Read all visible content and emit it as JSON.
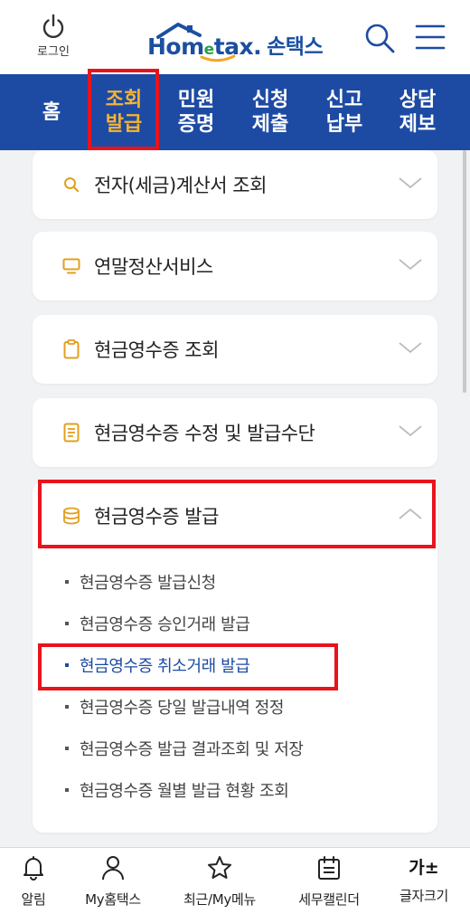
{
  "header": {
    "login_label": "로그인",
    "logo_text": "Hom",
    "logo_e": "e",
    "logo_tax": "tax.",
    "logo_korean": "손택스"
  },
  "tabs": [
    {
      "label": "홈",
      "active": false
    },
    {
      "label_line1": "조회",
      "label_line2": "발급",
      "active": true
    },
    {
      "label_line1": "민원",
      "label_line2": "증명",
      "active": false
    },
    {
      "label_line1": "신청",
      "label_line2": "제출",
      "active": false
    },
    {
      "label_line1": "신고",
      "label_line2": "납부",
      "active": false
    },
    {
      "label_line1": "상담",
      "label_line2": "제보",
      "active": false
    }
  ],
  "menu": {
    "items": [
      {
        "label": "전자(세금)계산서 조회",
        "icon": "search-icon",
        "expanded": false
      },
      {
        "label": "연말정산서비스",
        "icon": "monitor-icon",
        "expanded": false
      },
      {
        "label": "현금영수증 조회",
        "icon": "clipboard-icon",
        "expanded": false
      },
      {
        "label": "현금영수증 수정 및 발급수단",
        "icon": "document-icon",
        "expanded": false
      },
      {
        "label": "현금영수증 발급",
        "icon": "coin-stack-icon",
        "expanded": true
      }
    ],
    "sub_items": [
      {
        "label": "현금영수증 발급신청",
        "selected": false
      },
      {
        "label": "현금영수증 승인거래 발급",
        "selected": false
      },
      {
        "label": "현금영수증 취소거래 발급",
        "selected": true
      },
      {
        "label": "현금영수증 당일 발급내역 정정",
        "selected": false
      },
      {
        "label": "현금영수증 발급 결과조회 및 저장",
        "selected": false
      },
      {
        "label": "현금영수증 월별 발급 현황 조회",
        "selected": false
      }
    ]
  },
  "bottom_nav": [
    {
      "label": "알림",
      "icon": "bell-icon"
    },
    {
      "label": "My홈택스",
      "icon": "person-icon"
    },
    {
      "label": "최근/My메뉴",
      "icon": "star-icon"
    },
    {
      "label": "세무캘린더",
      "icon": "calendar-icon"
    },
    {
      "label": "글자크기",
      "icon": "font-size-icon",
      "glyph": "가±"
    }
  ],
  "colors": {
    "brand_blue": "#1d4ba3",
    "active_tab": "#f5b335",
    "icon_gold": "#e0a020",
    "highlight_red": "#e8141c"
  }
}
